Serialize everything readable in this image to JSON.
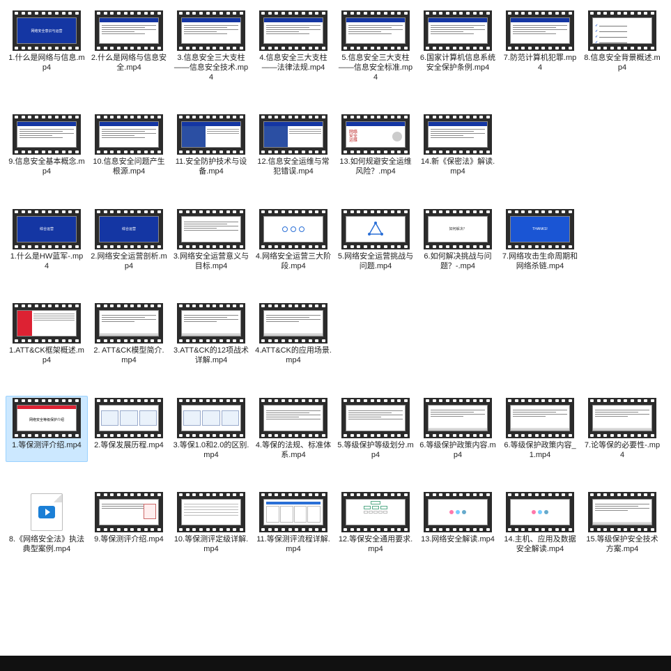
{
  "files": [
    {
      "name": "1.什么是网络与信息.mp4",
      "slide": "title",
      "text": "网络安全意识与运营",
      "selected": false
    },
    {
      "name": "2.什么是网络与信息安全.mp4",
      "slide": "header-lines",
      "selected": false
    },
    {
      "name": "3.信息安全三大支柱——信息安全技术.mp4",
      "slide": "header-lines",
      "selected": false
    },
    {
      "name": "4.信息安全三大支柱——法律法规.mp4",
      "slide": "header-lines",
      "selected": false
    },
    {
      "name": "5.信息安全三大支柱——信息安全标准.mp4",
      "slide": "header-lines",
      "selected": false
    },
    {
      "name": "6.国家计算机信息系统安全保护条例.mp4",
      "slide": "header-lines",
      "selected": false
    },
    {
      "name": "7.防范计算机犯罪.mp4",
      "slide": "header-lines",
      "selected": false
    },
    {
      "name": "8.信息安全背景概述.mp4",
      "slide": "check",
      "selected": false
    },
    {
      "name": "9.信息安全基本概念.mp4",
      "slide": "header-lines",
      "selected": false
    },
    {
      "name": "10.信息安全问题产生根源.mp4",
      "slide": "header-lines",
      "selected": false
    },
    {
      "name": "11.安全防护技术与设备.mp4",
      "slide": "img-left",
      "selected": false
    },
    {
      "name": "12.信息安全运维与常犯错误.mp4",
      "slide": "img-left",
      "selected": false
    },
    {
      "name": "13.如何规避安全运维风险？.mp4",
      "slide": "redtext",
      "selected": false
    },
    {
      "name": "14.新《保密法》解读.mp4",
      "slide": "header-lines",
      "selected": false
    },
    {
      "name": "1.什么是HW蓝军-.mp4",
      "slide": "title",
      "text": "综合运营",
      "selected": false
    },
    {
      "name": "2.网络安全运营剖析.mp4",
      "slide": "title",
      "text": "综合运营",
      "selected": false
    },
    {
      "name": "3.网络安全运营意义与目标.mp4",
      "slide": "lines",
      "selected": false
    },
    {
      "name": "4.网络安全运营三大阶段.mp4",
      "slide": "circles",
      "selected": false
    },
    {
      "name": "5.网络安全运营挑战与问题.mp4",
      "slide": "triangle",
      "selected": false
    },
    {
      "name": "6.如何解决挑战与问题？-.mp4",
      "slide": "center-text",
      "text": "如何解决？",
      "selected": false
    },
    {
      "name": "7.网络攻击生命周期和网络杀链.mp4",
      "slide": "blue-full",
      "text": "THANKS!",
      "selected": false
    },
    {
      "name": "1.ATT&CK框架概述.mp4",
      "slide": "red-left",
      "selected": false
    },
    {
      "name": "2.  ATT&CK模型简介.mp4",
      "slide": "skyline-lines",
      "selected": false
    },
    {
      "name": "3.ATT&CK的12项战术详解.mp4",
      "slide": "skyline-lines",
      "selected": false
    },
    {
      "name": "4.ATT&CK的应用场景.mp4",
      "slide": "skyline-lines",
      "selected": false
    },
    {
      "name": "1.等保测评介绍.mp4",
      "slide": "white-title",
      "text": "网络安全等级保护介绍",
      "selected": true
    },
    {
      "name": "2.等保发展历程.mp4",
      "slide": "boxes",
      "selected": false
    },
    {
      "name": "3.等保1.0和2.0的区别.mp4",
      "slide": "boxes",
      "selected": false
    },
    {
      "name": "4.等保的法规、标准体系.mp4",
      "slide": "lines",
      "selected": false
    },
    {
      "name": "5.等级保护等级划分.mp4",
      "slide": "lines",
      "selected": false
    },
    {
      "name": "6.等级保护政策内容.mp4",
      "slide": "skyline-lines",
      "selected": false
    },
    {
      "name": "6.等级保护政策内容_1.mp4",
      "slide": "skyline-lines",
      "selected": false
    },
    {
      "name": "7.论等保的必要性-.mp4",
      "slide": "skyline-lines",
      "selected": false
    },
    {
      "name": "8.《网络安全法》执法典型案例.mp4",
      "slide": "generic-video",
      "selected": false
    },
    {
      "name": "9.等保测评介绍.mp4",
      "slide": "lines-box",
      "selected": false
    },
    {
      "name": "10.等保测评定级详解.mp4",
      "slide": "table",
      "selected": false
    },
    {
      "name": "11.等保测评流程详解.mp4",
      "slide": "flow",
      "selected": false
    },
    {
      "name": "12.等保安全通用要求.mp4",
      "slide": "org",
      "selected": false
    },
    {
      "name": "13.网络安全解读.mp4",
      "slide": "diagram",
      "selected": false
    },
    {
      "name": "14.主机、应用及数据安全解读.mp4",
      "slide": "diagram",
      "selected": false
    },
    {
      "name": "15.等级保护安全技术方案.mp4",
      "slide": "skyline-lines",
      "selected": false
    }
  ],
  "row_breaks_after": [
    7,
    13,
    20,
    24,
    32
  ]
}
